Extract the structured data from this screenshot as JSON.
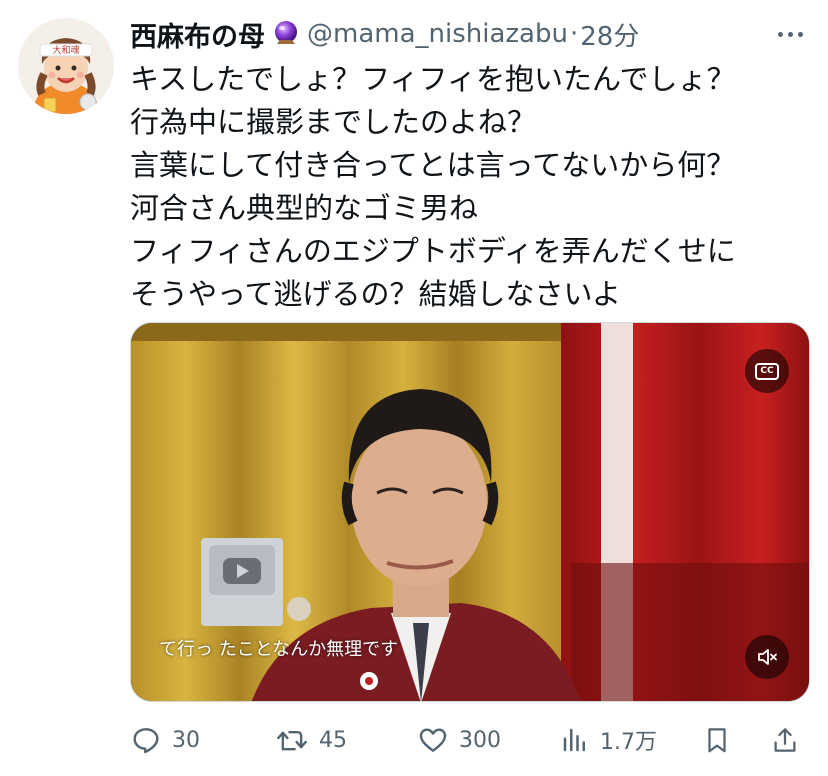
{
  "tweet": {
    "display_name": "西麻布の母",
    "handle": "@mama_nishiazabu",
    "separator": "·",
    "time": "28分",
    "avatar_label": "大和魂",
    "lines": [
      "キスしたでしょ？フィフィを抱いたんでしょ？",
      "行為中に撮影までしたのよね？",
      "言葉にして付き合ってとは言ってないから何？",
      "河合さん典型的なゴミ男ね",
      "フィフィさんのエジプトボディを弄んだくせに",
      "そうやって逃げるの？結婚しなさいよ"
    ]
  },
  "media": {
    "caption": "て行っ たことなんか無理です",
    "cc_label": "CC"
  },
  "actions": {
    "replies": "30",
    "reposts": "45",
    "likes": "300",
    "views": "1.7万"
  },
  "colors": {
    "text": "#0f1419",
    "secondary": "#536471",
    "border": "#cfd9de"
  }
}
